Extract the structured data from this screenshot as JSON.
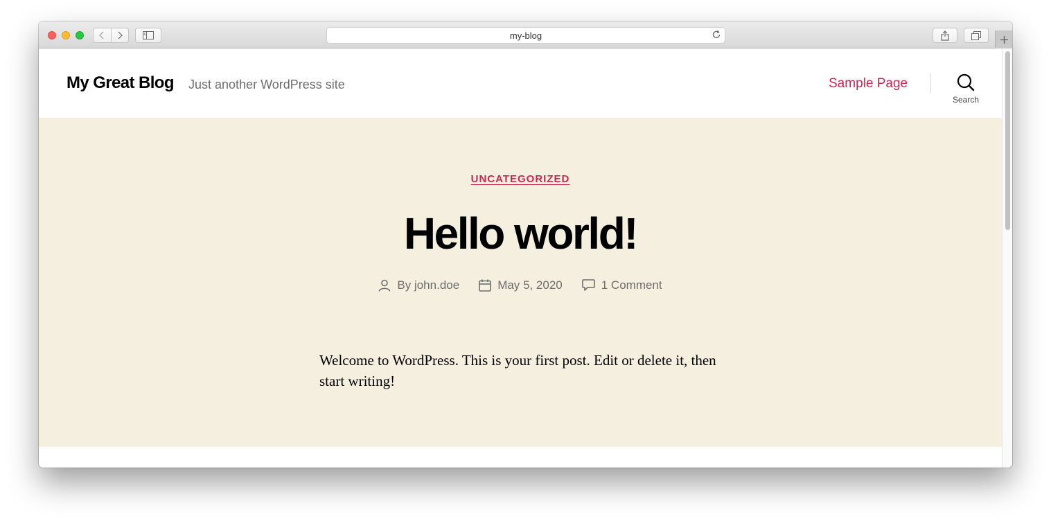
{
  "browser": {
    "url": "my-blog"
  },
  "site": {
    "title": "My Great Blog",
    "description": "Just another WordPress site",
    "nav": [
      {
        "label": "Sample Page"
      }
    ],
    "search_label": "Search",
    "accent_color": "#cd2653",
    "hero_background": "#f5efe0"
  },
  "post": {
    "category": "UNCATEGORIZED",
    "title": "Hello world!",
    "author": "john.doe",
    "author_prefix": "By",
    "date": "May 5, 2020",
    "comments": "1 Comment",
    "excerpt": "Welcome to WordPress. This is your first post. Edit or delete it, then start writing!"
  },
  "icons": {
    "author": "person-icon",
    "date": "calendar-icon",
    "comments": "comment-bubble-icon",
    "search": "search-icon"
  }
}
